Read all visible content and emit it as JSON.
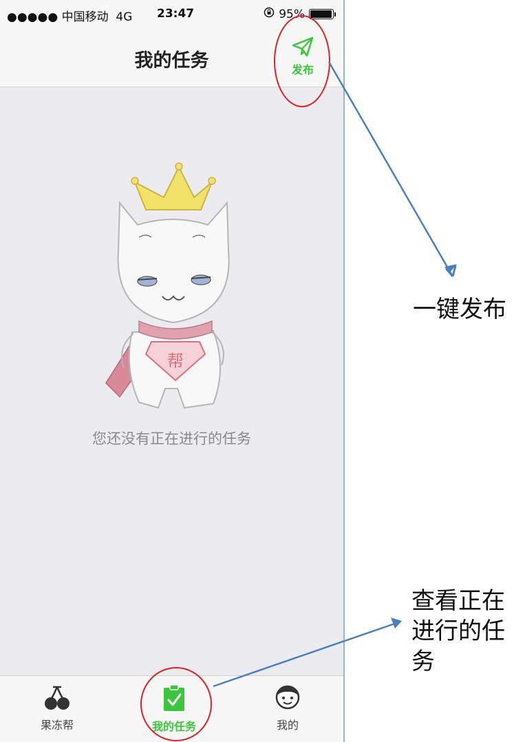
{
  "status_bar": {
    "carrier": "●●●●● 中国移动",
    "network": "4G",
    "time": "23:47",
    "battery": "95%",
    "lock_icon": "rotation-lock-icon"
  },
  "nav": {
    "title": "我的任务",
    "publish_label": "发布",
    "publish_icon": "paper-plane-icon"
  },
  "empty_state": {
    "message": "您还没有正在进行的任务",
    "mascot_badge": "帮"
  },
  "tabs": [
    {
      "label": "果冻帮",
      "icon": "cherry-icon",
      "active": false
    },
    {
      "label": "我的任务",
      "icon": "clipboard-check-icon",
      "active": true
    },
    {
      "label": "我的",
      "icon": "face-icon",
      "active": false
    }
  ],
  "annotations": {
    "publish_note": "一键发布",
    "tasks_note": "查看正在进行的任务"
  },
  "colors": {
    "accent_green": "#3cc63c",
    "highlight_red": "#e02020",
    "arrow_blue": "#4a7fc1"
  }
}
